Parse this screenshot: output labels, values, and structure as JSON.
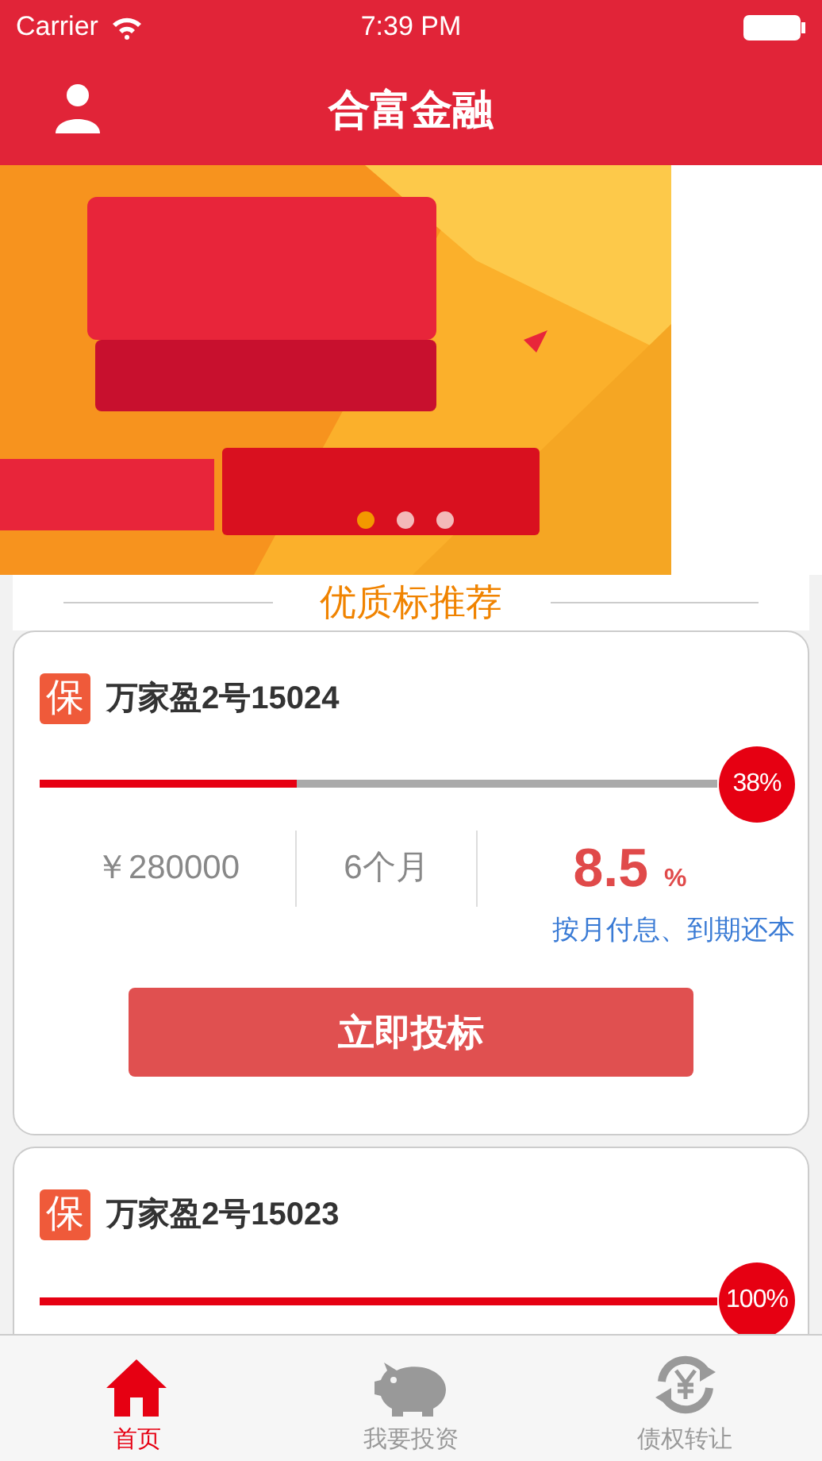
{
  "status_bar": {
    "carrier": "Carrier",
    "time": "7:39 PM"
  },
  "nav": {
    "title": "合富金融"
  },
  "banner": {
    "kind": "picture",
    "dots": [
      {
        "selected": true
      },
      {
        "selected": false
      },
      {
        "selected": false
      }
    ]
  },
  "section": {
    "title": "优质标推荐"
  },
  "products": [
    {
      "badge": "保",
      "name": "万家盈2号15024",
      "level": 0.38,
      "percent": "38%",
      "amount": "￥280000",
      "term": "6个月",
      "rate": "8.5",
      "rate_unit": "%",
      "repayment": "按月付息、到期还本",
      "button": "立即投标"
    },
    {
      "badge": "保",
      "name": "万家盈2号15023",
      "level": 1,
      "percent": "100%"
    }
  ],
  "tabs": [
    {
      "label": "首页",
      "kind": "home",
      "selected": true
    },
    {
      "label": "我要投资",
      "kind": "piggy",
      "selected": false
    },
    {
      "label": "债权转让",
      "kind": "exchange",
      "selected": false
    }
  ]
}
